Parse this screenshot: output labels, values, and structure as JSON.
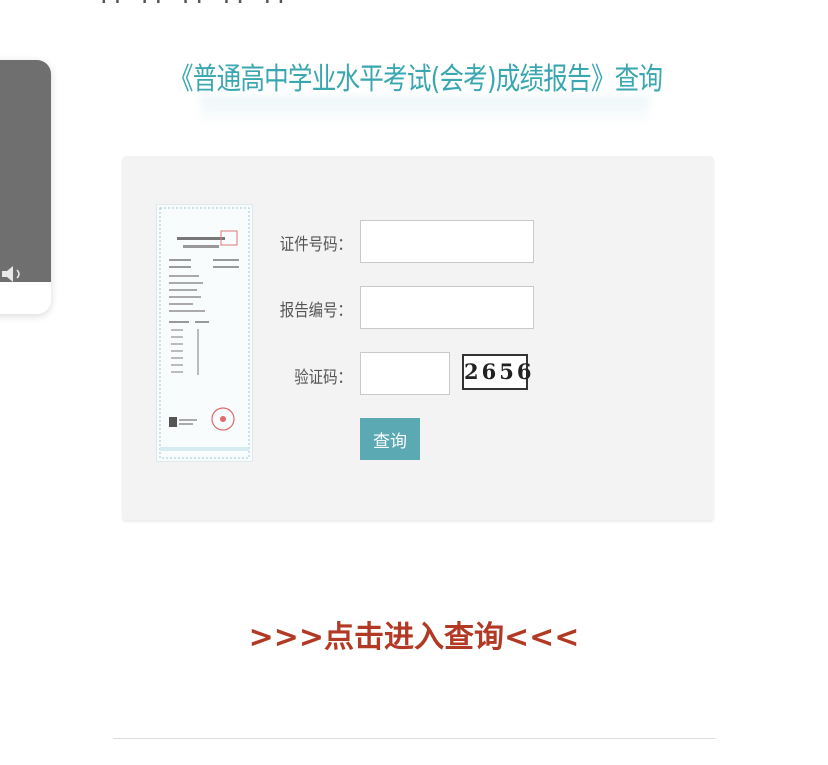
{
  "header": {
    "top_cut_text": "·· ·· ·· ·· ··",
    "title": "《普通高中学业水平考试(会考)成绩报告》查询"
  },
  "form": {
    "id_label": "证件号码：",
    "id_value": "",
    "report_label": "报告编号：",
    "report_value": "",
    "captcha_label": "验证码：",
    "captcha_value": "",
    "captcha_text": "2656",
    "submit_label": "查询"
  },
  "link": {
    "enter_text": ">>>点击进入查询<<<"
  },
  "colors": {
    "accent": "#3aa7b0",
    "button": "#5ba9b3",
    "link": "#b23a25"
  },
  "icons": [
    "speaker-icon",
    "certificate-image"
  ]
}
